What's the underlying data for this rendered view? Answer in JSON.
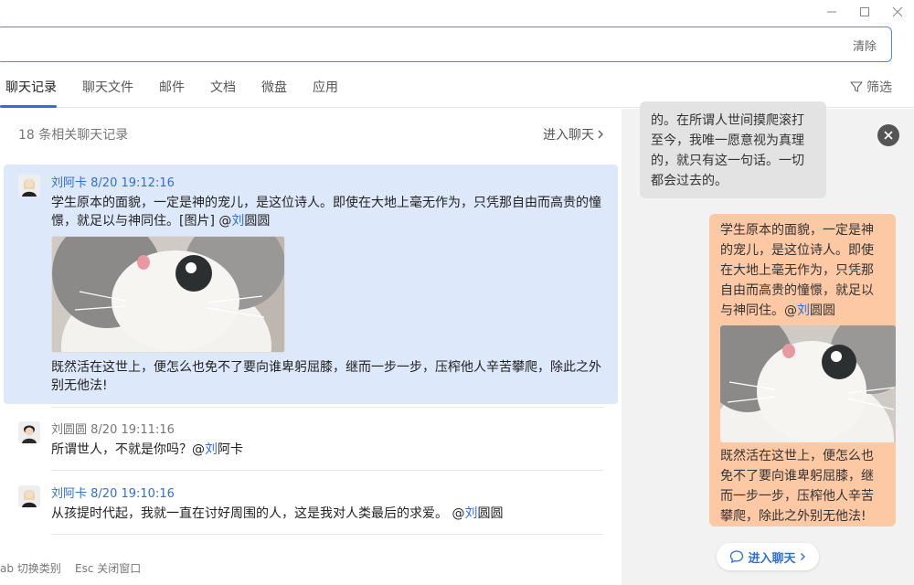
{
  "window": {
    "controls": [
      "minimize",
      "maximize",
      "close"
    ]
  },
  "search": {
    "value": "",
    "placeholder": "",
    "clear_label": "清除"
  },
  "tabs": [
    {
      "label": "聊天记录",
      "active": true
    },
    {
      "label": "聊天文件"
    },
    {
      "label": "邮件"
    },
    {
      "label": "文档"
    },
    {
      "label": "微盘"
    },
    {
      "label": "应用"
    }
  ],
  "filter_label": "筛选",
  "list": {
    "count_label": "18 条相关聊天记录",
    "enter_label": "进入聊天",
    "messages": [
      {
        "sender": "刘阿卡",
        "time": "8/20 19:12:16",
        "text_before": "学生原本的面貌，一定是神的宠儿，是这位诗人。即使在大地上毫无作为，只凭那自由而高贵的憧憬，就足以与神同住。[图片] @",
        "mention": "刘",
        "text_after": "圆圆",
        "image": "cat-photo",
        "text2": "既然活在这世上，便怎么也免不了要向谁卑躬屈膝，继而一步一步，压榨他人辛苦攀爬，除此之外别无他法!"
      },
      {
        "sender": "刘圆圆",
        "time": "8/20 19:11:16",
        "text_before": "所谓世人，不就是你吗？@",
        "mention": "刘",
        "text_after": "阿卡"
      },
      {
        "sender": "刘阿卡",
        "time": "8/20 19:10:16",
        "text_before": "从孩提时代起，我就一直在讨好周围的人，这是我对人类最后的求爱。 @",
        "mention": "刘",
        "text_after": "圆圆"
      }
    ]
  },
  "hint": "ab 切换类别    Esc 关闭窗口",
  "preview": {
    "gray_bubble": "的。在所谓人世间摸爬滚打至今，我唯一愿意视为真理的，就只有这一句话。一切都会过去的。",
    "orange_before": "学生原本的面貌，一定是神的宠儿，是这位诗人。即使在大地上毫无作为，只凭那自由而高贵的憧憬，就足以与神同住。@",
    "orange_mention": "刘",
    "orange_after": "圆圆",
    "orange_text2": "既然活在这世上，便怎么也免不了要向谁卑躬屈膝，继而一步一步，压榨他人辛苦攀爬，除此之外别无他法!",
    "enter_label": "进入聊天"
  },
  "colors": {
    "accent": "#2f6fd6",
    "selected_bg": "#dde9fb",
    "bubble_orange": "#fdc9a5",
    "bubble_gray": "#e3e3e3",
    "panel_bg": "#f2f2f2"
  }
}
